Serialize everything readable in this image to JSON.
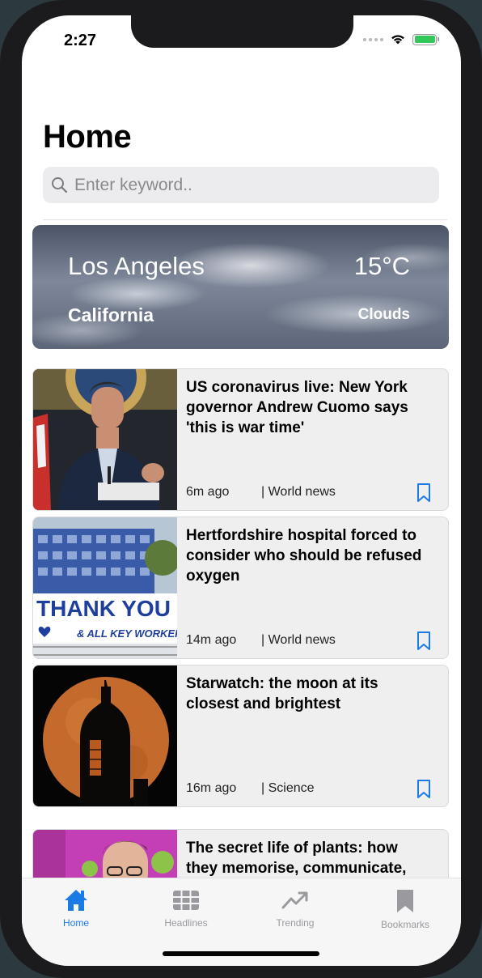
{
  "status_bar": {
    "time": "2:27"
  },
  "header": {
    "title": "Home"
  },
  "search": {
    "placeholder": "Enter keyword.."
  },
  "weather": {
    "city": "Los Angeles",
    "state": "California",
    "temperature": "15°C",
    "condition": "Clouds"
  },
  "articles": [
    {
      "headline": "US coronavirus live: New York governor Andrew Cuomo says 'this is war time'",
      "time": "6m ago",
      "category": "| World news",
      "image": "governor-press-conference-photo"
    },
    {
      "headline": "Hertfordshire hospital forced to consider who should be refused oxygen",
      "time": "14m ago",
      "category": "| World news",
      "image": "hospital-building-thank-you-banner-photo",
      "banner_line1": "THANK YOU",
      "banner_line2": "& ALL KEY WORKER"
    },
    {
      "headline": "Starwatch: the moon at its closest and brightest",
      "time": "16m ago",
      "category": "| Science",
      "image": "moon-behind-tower-photo"
    },
    {
      "headline": "The secret life of plants: how they memorise, communicate, problem",
      "time": "",
      "category": "",
      "image": "man-with-plants-photo"
    }
  ],
  "tabbar": {
    "items": [
      {
        "label": "Home",
        "icon": "house-icon",
        "active": true
      },
      {
        "label": "Headlines",
        "icon": "grid-icon",
        "active": false
      },
      {
        "label": "Trending",
        "icon": "trend-arrow-icon",
        "active": false
      },
      {
        "label": "Bookmarks",
        "icon": "bookmark-icon",
        "active": false
      }
    ]
  },
  "colors": {
    "accent": "#1a7be6",
    "inactive_tab": "#9a9a9e",
    "card_background": "#efeff0",
    "battery": "#34c759"
  }
}
